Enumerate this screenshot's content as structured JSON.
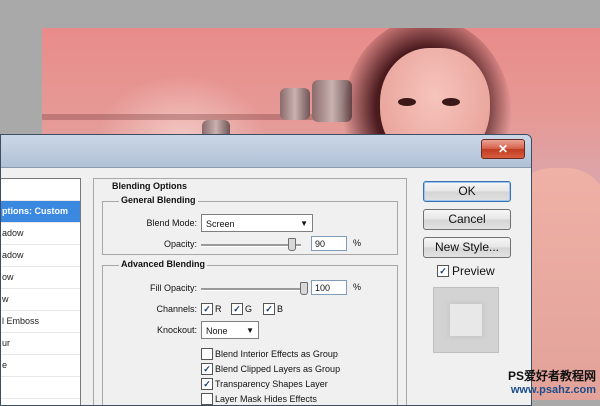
{
  "dialog": {
    "close_label": "✕",
    "styles": [
      {
        "label": ""
      },
      {
        "label": "ptions: Custom",
        "selected": true
      },
      {
        "label": "adow"
      },
      {
        "label": "adow"
      },
      {
        "label": "ow"
      },
      {
        "label": "w"
      },
      {
        "label": "l Emboss"
      },
      {
        "label": "ur"
      },
      {
        "label": "e"
      },
      {
        "label": ""
      }
    ],
    "panel_title": "Blending Options",
    "general": {
      "title": "General Blending",
      "blend_mode_label": "Blend Mode:",
      "blend_mode_value": "Screen",
      "opacity_label": "Opacity:",
      "opacity_value": "90",
      "opacity_fraction": 0.9,
      "percent": "%"
    },
    "advanced": {
      "title": "Advanced Blending",
      "fill_opacity_label": "Fill Opacity:",
      "fill_opacity_value": "100",
      "fill_opacity_fraction": 1.0,
      "percent": "%",
      "channels_label": "Channels:",
      "channels": [
        {
          "label": "R",
          "checked": true
        },
        {
          "label": "G",
          "checked": true
        },
        {
          "label": "B",
          "checked": true
        }
      ],
      "knockout_label": "Knockout:",
      "knockout_value": "None",
      "options": [
        {
          "label": "Blend Interior Effects as Group",
          "checked": false
        },
        {
          "label": "Blend Clipped Layers as Group",
          "checked": true
        },
        {
          "label": "Transparency Shapes Layer",
          "checked": true
        },
        {
          "label": "Layer Mask Hides Effects",
          "checked": false
        }
      ]
    },
    "buttons": {
      "ok": "OK",
      "cancel": "Cancel",
      "new_style": "New Style..."
    },
    "preview": {
      "label": "Preview",
      "checked": true
    }
  },
  "watermark": {
    "line1": "PS爱好者教程网",
    "line2": "www.psahz.com"
  },
  "check_glyph": "✓"
}
